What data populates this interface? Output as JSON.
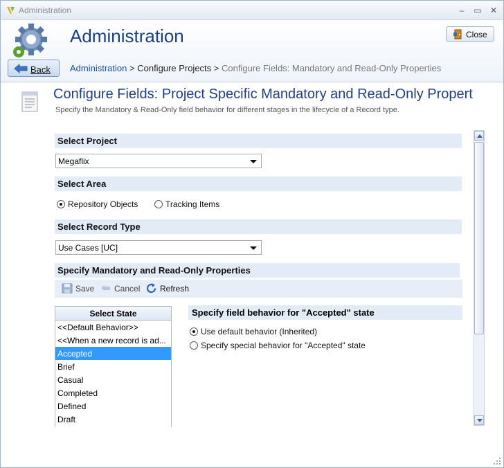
{
  "window": {
    "title": "Administration",
    "controls": [
      "–",
      "▭",
      "✕"
    ]
  },
  "header": {
    "title": "Administration",
    "close_label": "Close",
    "back_label": "Back"
  },
  "breadcrumb": {
    "items": [
      "Administration",
      "Configure Projects",
      "Configure Fields: Mandatory and Read-Only Properties"
    ],
    "separator": ">"
  },
  "page": {
    "title": "Configure Fields: Project Specific Mandatory and Read-Only Propert",
    "description": "Specify the Mandatory & Read-Only field behavior for different stages in the lifecycle of a Record type."
  },
  "select_project": {
    "label": "Select Project",
    "value": "Megaflix"
  },
  "select_area": {
    "label": "Select Area",
    "options": [
      {
        "label": "Repository Objects",
        "checked": true
      },
      {
        "label": "Tracking Items",
        "checked": false
      }
    ]
  },
  "select_record_type": {
    "label": "Select Record Type",
    "value": "Use Cases [UC]"
  },
  "properties": {
    "label": "Specify Mandatory and Read-Only Properties",
    "toolbar": {
      "save": "Save",
      "cancel": "Cancel",
      "refresh": "Refresh"
    },
    "state_list": {
      "header": "Select State",
      "items": [
        "<<Default Behavior>>",
        "<<When a new record is ad...",
        "Accepted",
        "Brief",
        "Casual",
        "Completed",
        "Defined",
        "Draft"
      ],
      "selected": "Accepted"
    },
    "behavior": {
      "header": "Specify field behavior for \"Accepted\" state",
      "options": [
        {
          "label": "Use default behavior (Inherited)",
          "checked": true
        },
        {
          "label": "Specify special behavior for \"Accepted\" state",
          "checked": false
        }
      ]
    }
  },
  "colors": {
    "title_blue": "#1d3f84",
    "link_blue": "#1b4ea0",
    "section_bg": "#e3ebf6",
    "selection": "#3399ff"
  }
}
